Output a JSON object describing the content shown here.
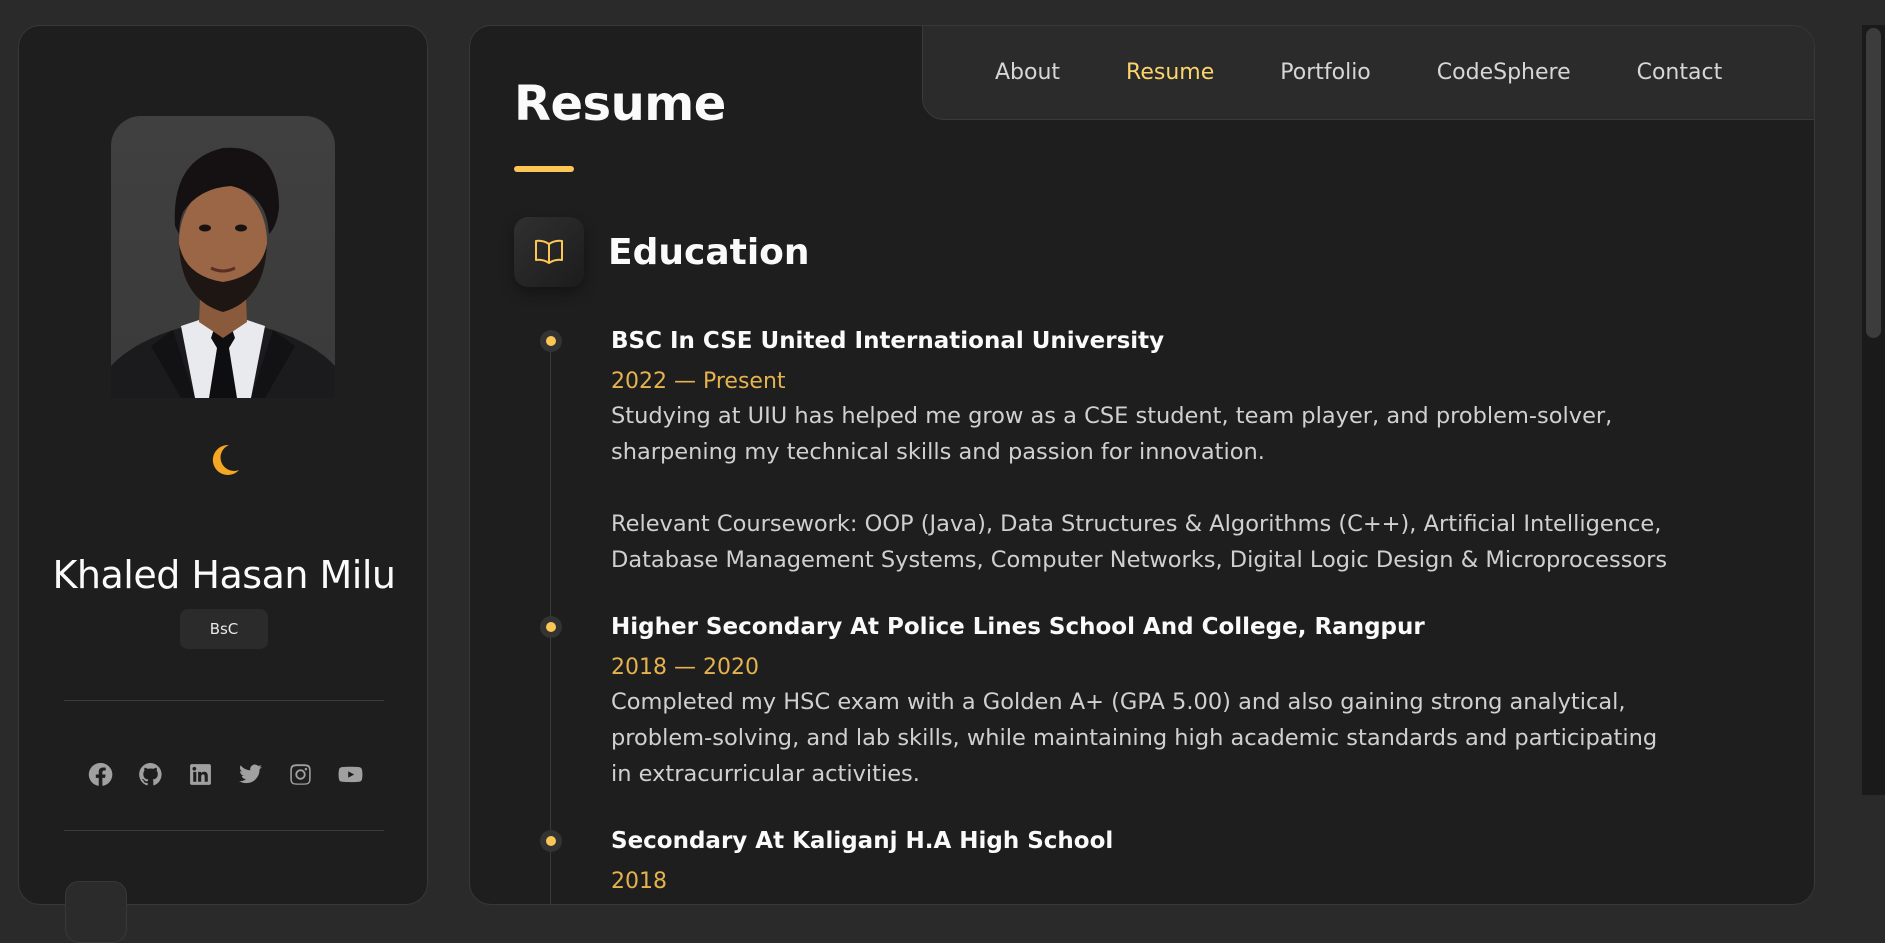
{
  "sidebar": {
    "name": "Khaled Hasan Milu",
    "badge": "BsC",
    "theme_icon": "moon-icon",
    "avatar_alt": "profile-photo",
    "socials": [
      {
        "icon": "facebook-icon"
      },
      {
        "icon": "github-icon"
      },
      {
        "icon": "linkedin-icon"
      },
      {
        "icon": "twitter-icon"
      },
      {
        "icon": "instagram-icon"
      },
      {
        "icon": "youtube-icon"
      }
    ]
  },
  "nav": {
    "items": [
      "About",
      "Resume",
      "Portfolio",
      "CodeSphere",
      "Contact"
    ],
    "active": "Resume"
  },
  "main": {
    "title": "Resume",
    "section": {
      "icon": "book-icon",
      "title": "Education",
      "items": [
        {
          "title": "BSC In CSE United International University",
          "date": "2022 — Present",
          "paragraphs": [
            "Studying at UIU has helped me grow as a CSE student, team player, and problem-solver, sharpening my technical skills and passion for innovation.",
            "Relevant Coursework: OOP (Java), Data Structures & Algorithms (C++), Artificial Intelligence, Database Management Systems, Computer Networks, Digital Logic Design & Microprocessors"
          ]
        },
        {
          "title": "Higher Secondary At Police Lines School And College, Rangpur",
          "date": "2018 — 2020",
          "paragraphs": [
            "Completed my HSC exam with a Golden A+ (GPA 5.00) and also gaining strong analytical, problem-solving, and lab skills, while maintaining high academic standards and participating in extracurricular activities."
          ]
        },
        {
          "title": "Secondary At Kaliganj H.A High School",
          "date": "2018",
          "paragraphs": []
        }
      ]
    }
  },
  "colors": {
    "accent": "#fbc654",
    "active_nav": "#fbd46b",
    "date": "#e6b24e",
    "panel_bg": "#1e1e1f",
    "page_bg": "#2a2a2a"
  }
}
